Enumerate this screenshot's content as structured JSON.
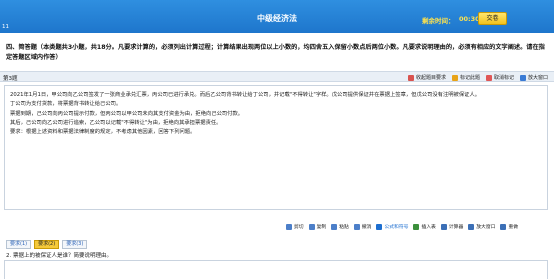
{
  "header": {
    "title": "中级经济法",
    "timer_label": "剩余时间：",
    "timer": "00:30:35",
    "submit_label": "交卷",
    "question_index": "11"
  },
  "instructions": "四、简答题（本类题共3小题，共18分。凡要求计算的，必须列出计算过程；计算结果出现两位以上小数的，均四舍五入保留小数点后两位小数。凡要求说明理由的，必须有相应的文字阐述。请在指定答题区域内作答）",
  "question_bar": {
    "label": "第3题",
    "tools": [
      {
        "icon": "hint-icon",
        "label": "收起题目要求",
        "color": "#d9534f"
      },
      {
        "icon": "flag-icon",
        "label": "标记此题",
        "color": "#e8a317"
      },
      {
        "icon": "unflag-icon",
        "label": "取消标记",
        "color": "#e05656"
      },
      {
        "icon": "zoom-icon",
        "label": "放大窗口",
        "color": "#3a7bd5"
      }
    ]
  },
  "content": [
    "2021年1月1日，甲公司向乙公司签发了一张商业承兑汇票，丙公司已进行承兑。而后乙公司背书转让给丁公司，并记载\"不得转让\"字样。戊公司提供保证并在票据上签章，但戊公司没有注明被保证人。",
    "丁公司为支付货款，将票据背书转让给己公司。",
    "票据到期，己公司向丙公司提示付款，但丙公司以甲公司未向其支付资金为由，拒绝向己公司付款。",
    "其后，己公司向乙公司进行追索，乙公司以记载\"不得转让\"为由，拒绝向其承担票据责任。",
    "要求：根据上述资料和票据法律制度的规定，不考虑其他因素，回答下列问题。"
  ],
  "edit_tools": [
    {
      "icon": "cut-icon",
      "label": "剪切",
      "color": "#4c7fc9"
    },
    {
      "icon": "copy-icon",
      "label": "复制",
      "color": "#4c7fc9"
    },
    {
      "icon": "paste-icon",
      "label": "粘贴",
      "color": "#4c7fc9"
    },
    {
      "icon": "undo-icon",
      "label": "撤消",
      "color": "#4c7fc9"
    },
    {
      "icon": "formula-icon",
      "label": "公式和符号",
      "color": "#1e6fd0"
    },
    {
      "icon": "table-icon",
      "label": "插入表",
      "color": "#3b8f3b"
    },
    {
      "icon": "calculator-icon",
      "label": "计算器",
      "color": "#3b6fb6"
    },
    {
      "icon": "enlarge-icon",
      "label": "放大窗口",
      "color": "#3b6fb6"
    },
    {
      "icon": "reset-icon",
      "label": "重做",
      "color": "#3b6fb6"
    }
  ],
  "tabs": [
    {
      "label": "要求(1)",
      "active": false
    },
    {
      "label": "要求(2)",
      "active": true
    },
    {
      "label": "要求(3)",
      "active": false
    }
  ],
  "sub_question": "2. 票据上的被保证人是谁？简要说明理由。"
}
